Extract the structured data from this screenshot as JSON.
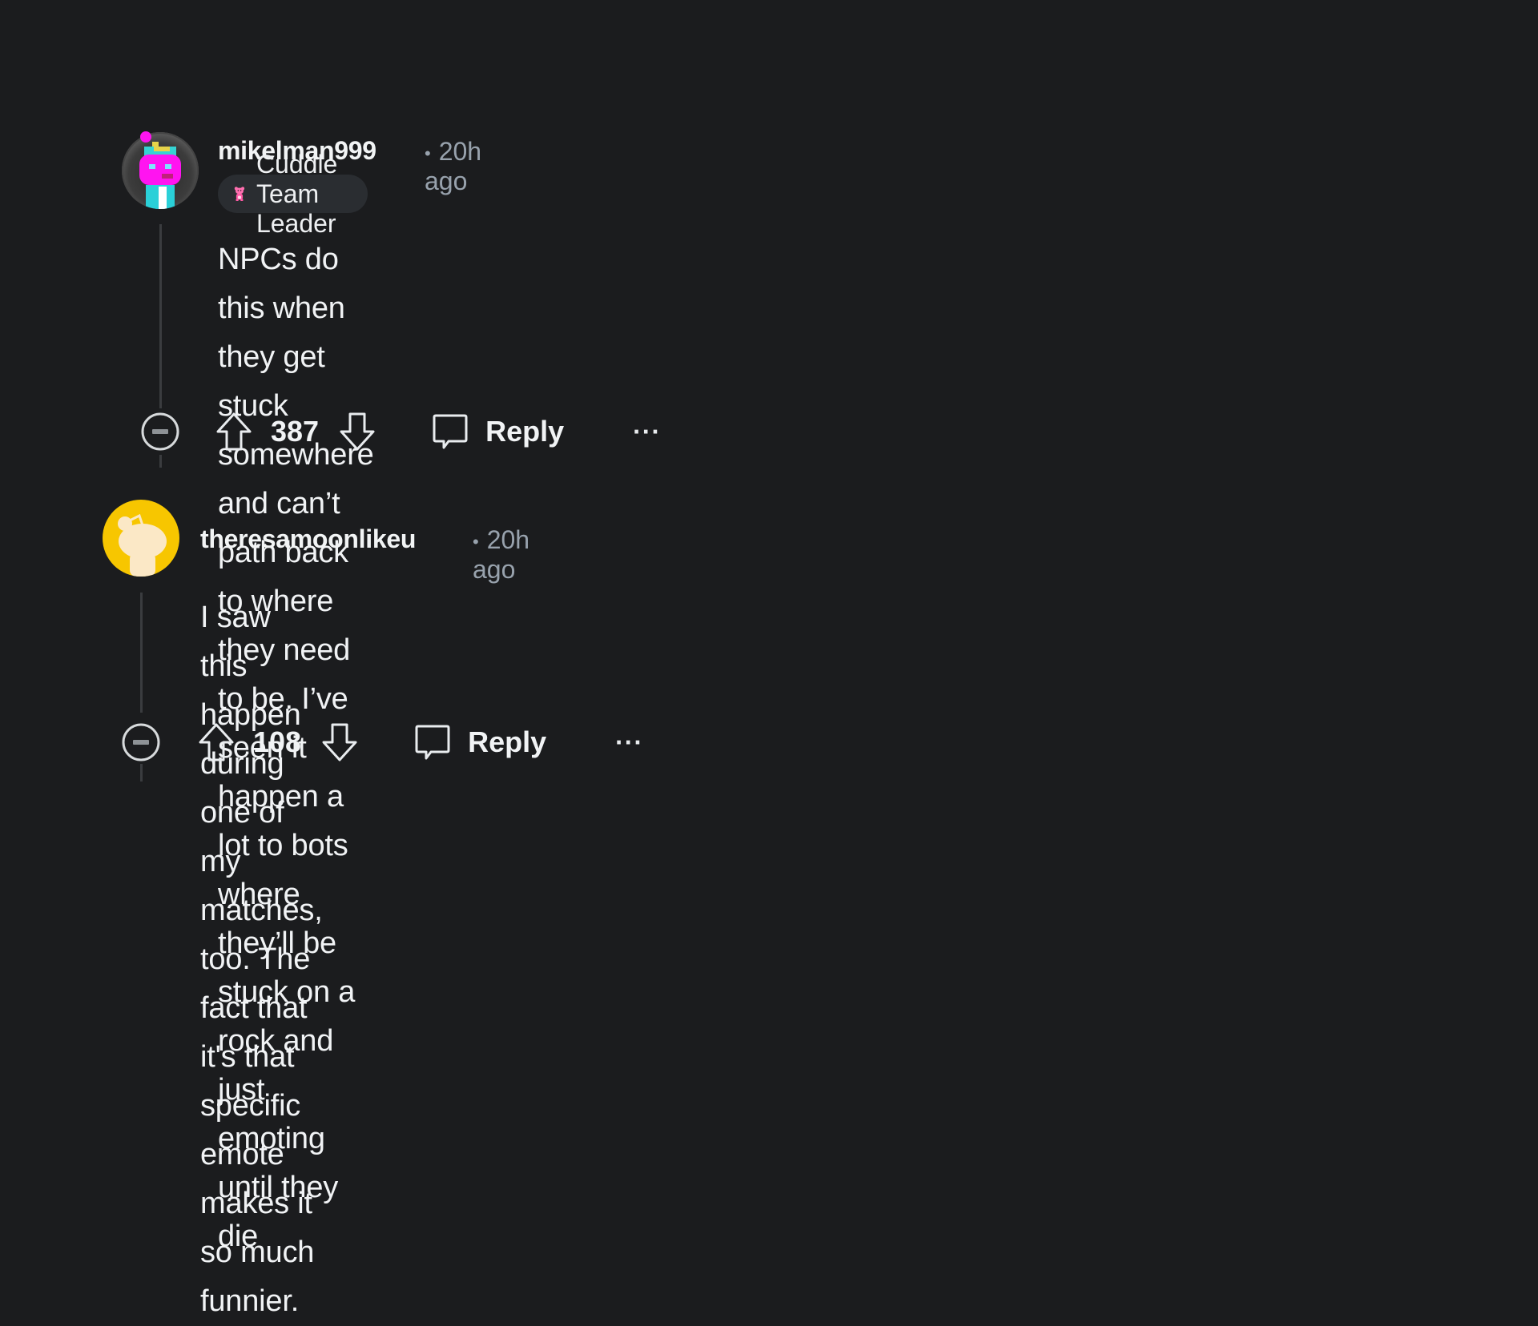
{
  "comments": [
    {
      "username": "mikelman999",
      "separator": "•",
      "time": "20h ago",
      "flair": {
        "label": "Cuddle Team Leader",
        "icon": "pink-bear-icon"
      },
      "avatar": "snoo-avatar-magenta",
      "text": "NPCs do this when they get stuck somewhere and can’t path back to where\nthey need to be. I’ve seen it happen a lot to bots where they’ll be stuck on a\nrock and just emoting until they die",
      "votes": "387",
      "reply_label": "Reply",
      "more_label": "···",
      "icons": {
        "collapse": "collapse-minus-icon",
        "upvote": "upvote-arrow-icon",
        "downvote": "downvote-arrow-icon",
        "reply": "speech-bubble-icon",
        "more": "more-dots-icon"
      }
    },
    {
      "username": "theresamoonlikeu",
      "separator": "•",
      "time": "20h ago",
      "avatar": "snoo-avatar-yellow",
      "text": "I saw this happen during one of my matches, too. The fact that it's that specific\nemote makes it so much funnier.",
      "votes": "108",
      "reply_label": "Reply",
      "more_label": "···",
      "icons": {
        "collapse": "collapse-minus-icon",
        "upvote": "upvote-arrow-icon",
        "downvote": "downvote-arrow-icon",
        "reply": "speech-bubble-icon",
        "more": "more-dots-icon"
      }
    }
  ],
  "colors": {
    "background": "#1b1c1e",
    "text": "#f1f3f5",
    "meta": "#98a2ad",
    "flair_bg": "#2a2d31",
    "avatar_yellow": "#f7c600",
    "avatar_magenta": "#ff14f0"
  }
}
